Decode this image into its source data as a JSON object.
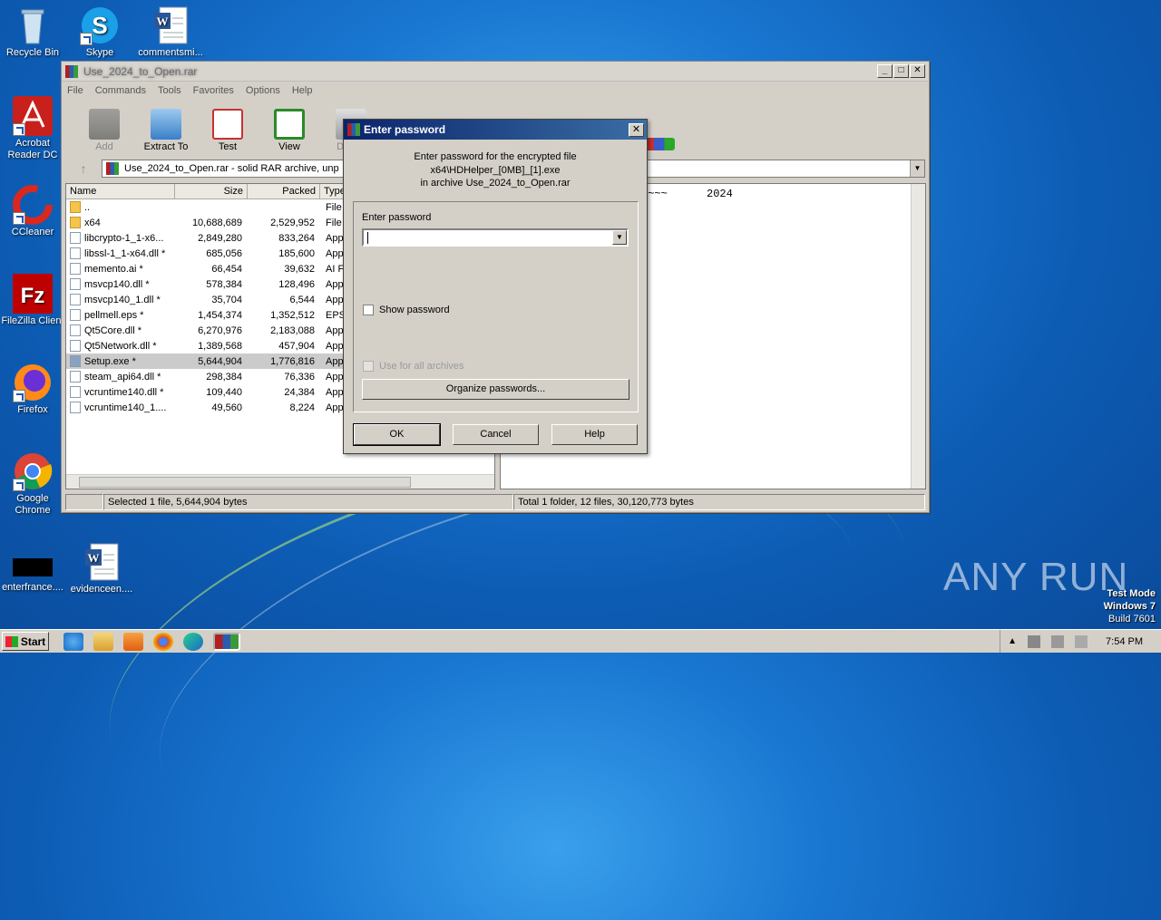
{
  "desktop": {
    "icons": [
      {
        "label": "Recycle Bin",
        "icon": "recycle-bin-icon"
      },
      {
        "label": "Skype",
        "icon": "skype-icon"
      },
      {
        "label": "commentsmi...",
        "icon": "word-doc-icon"
      },
      {
        "label": "Acrobat Reader DC",
        "icon": "acrobat-icon"
      },
      {
        "label": "CCleaner",
        "icon": "ccleaner-icon"
      },
      {
        "label": "FileZilla Client",
        "icon": "filezilla-icon"
      },
      {
        "label": "Firefox",
        "icon": "firefox-icon"
      },
      {
        "label": "Google Chrome",
        "icon": "chrome-icon"
      },
      {
        "label": "enterfrance....",
        "icon": "black-file-icon"
      },
      {
        "label": "evidenceen....",
        "icon": "word-doc-icon"
      }
    ]
  },
  "winrar": {
    "title": "Use_2024_to_Open.rar",
    "menu": [
      "File",
      "Commands",
      "Tools",
      "Favorites",
      "Options",
      "Help"
    ],
    "toolbar": [
      "Add",
      "Extract To",
      "Test",
      "View",
      "Delete"
    ],
    "address": "Use_2024_to_Open.rar - solid RAR archive, unp",
    "columns": [
      "Name",
      "Size",
      "Packed",
      "Type"
    ],
    "files": [
      {
        "name": "..",
        "size": "",
        "packed": "",
        "type": "File I",
        "kind": "folder"
      },
      {
        "name": "x64",
        "size": "10,688,689",
        "packed": "2,529,952",
        "type": "File I",
        "kind": "folder"
      },
      {
        "name": "libcrypto-1_1-x6...",
        "size": "2,849,280",
        "packed": "833,264",
        "type": "Appl",
        "kind": "dll"
      },
      {
        "name": "libssl-1_1-x64.dll *",
        "size": "685,056",
        "packed": "185,600",
        "type": "Appl",
        "kind": "dll"
      },
      {
        "name": "memento.ai *",
        "size": "66,454",
        "packed": "39,632",
        "type": "AI F",
        "kind": "file"
      },
      {
        "name": "msvcp140.dll *",
        "size": "578,384",
        "packed": "128,496",
        "type": "Appl",
        "kind": "dll"
      },
      {
        "name": "msvcp140_1.dll *",
        "size": "35,704",
        "packed": "6,544",
        "type": "Appl",
        "kind": "dll"
      },
      {
        "name": "pellmell.eps *",
        "size": "1,454,374",
        "packed": "1,352,512",
        "type": "EPS",
        "kind": "file"
      },
      {
        "name": "Qt5Core.dll *",
        "size": "6,270,976",
        "packed": "2,183,088",
        "type": "Appl",
        "kind": "dll"
      },
      {
        "name": "Qt5Network.dll *",
        "size": "1,389,568",
        "packed": "457,904",
        "type": "Appl",
        "kind": "dll"
      },
      {
        "name": "Setup.exe *",
        "size": "5,644,904",
        "packed": "1,776,816",
        "type": "Appl",
        "kind": "exe",
        "selected": true
      },
      {
        "name": "steam_api64.dll *",
        "size": "298,384",
        "packed": "76,336",
        "type": "Appl",
        "kind": "dll"
      },
      {
        "name": "vcruntime140.dll *",
        "size": "109,440",
        "packed": "24,384",
        "type": "Appl",
        "kind": "dll"
      },
      {
        "name": "vcruntime140_1....",
        "size": "49,560",
        "packed": "8,224",
        "type": "Appl",
        "kind": "dll"
      }
    ],
    "comment": "~~~~      2024",
    "status_left": "Selected 1 file, 5,644,904 bytes",
    "status_right": "Total 1 folder, 12 files, 30,120,773 bytes"
  },
  "dialog": {
    "title": "Enter password",
    "info_line1": "Enter password for the encrypted file",
    "info_line2": "x64\\HDHelper_[0MB]_[1].exe",
    "info_line3": "in archive Use_2024_to_Open.rar",
    "password_label": "Enter password",
    "password_value": "",
    "show_password": "Show password",
    "use_for_all": "Use for all archives",
    "organize": "Organize passwords...",
    "ok": "OK",
    "cancel": "Cancel",
    "help": "Help"
  },
  "taskbar": {
    "start": "Start",
    "time": "7:54 PM"
  },
  "overlay": {
    "watermark": "ANY RUN",
    "test_mode": "Test Mode",
    "os": "Windows 7",
    "build": "Build 7601"
  }
}
